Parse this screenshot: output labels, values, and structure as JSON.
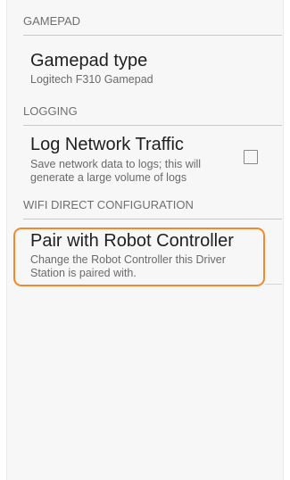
{
  "sections": {
    "gamepad": {
      "header": "GAMEPAD",
      "title": "Gamepad type",
      "summary": "Logitech F310 Gamepad"
    },
    "logging": {
      "header": "LOGGING",
      "title": "Log Network Traffic",
      "summary_line1": "Save network data to logs; this will",
      "summary_line2": "generate a large volume of logs",
      "checked": false
    },
    "wifi": {
      "header": "WIFI DIRECT CONFIGURATION",
      "title": "Pair with Robot Controller",
      "summary_line1": "Change the Robot Controller this Driver",
      "summary_line2": "Station is paired with."
    }
  },
  "colors": {
    "highlight": "#f08a2c",
    "header_text": "#6f6f6f"
  }
}
